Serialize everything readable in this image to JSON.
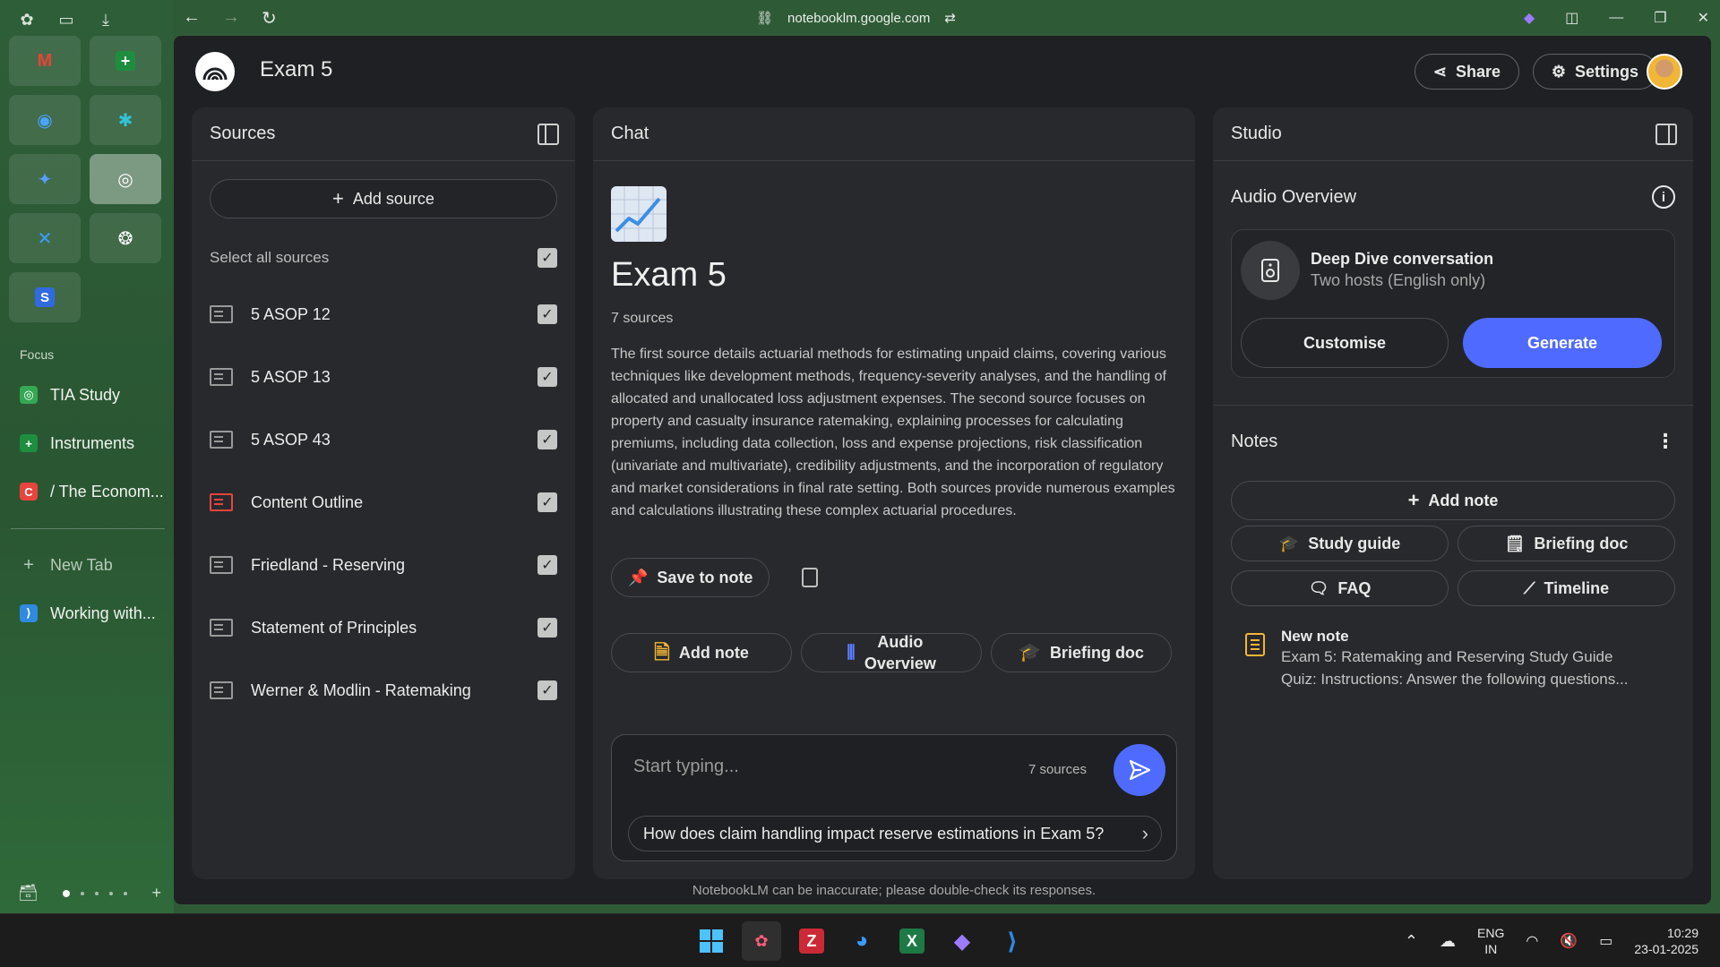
{
  "browser": {
    "url": "notebooklm.google.com",
    "focus_label": "Focus",
    "focus_items": [
      {
        "label": "TIA Study",
        "icon": "tia-study-icon",
        "color": "#34a853"
      },
      {
        "label": "Instruments",
        "icon": "sheets-icon",
        "color": "#1e8e3e"
      },
      {
        "label": "/ The Econom...",
        "icon": "economist-icon",
        "color": "#e8453c"
      }
    ],
    "new_tab_label": "New Tab",
    "pinned_item": {
      "label": "Working with...",
      "icon": "vscode-icon",
      "color": "#2f8ae0"
    }
  },
  "header": {
    "title": "Exam 5",
    "share_label": "Share",
    "settings_label": "Settings"
  },
  "sources": {
    "title": "Sources",
    "add_source_label": "Add source",
    "select_all_label": "Select all sources",
    "items": [
      {
        "name": "5 ASOP 12",
        "type": "text"
      },
      {
        "name": "5 ASOP 13",
        "type": "text"
      },
      {
        "name": "5 ASOP 43",
        "type": "text"
      },
      {
        "name": "Content Outline",
        "type": "pdf"
      },
      {
        "name": "Friedland - Reserving",
        "type": "text"
      },
      {
        "name": "Statement of Principles",
        "type": "text"
      },
      {
        "name": "Werner & Modlin - Ratemaking",
        "type": "text"
      }
    ]
  },
  "chat": {
    "title": "Chat",
    "notebook_title": "Exam 5",
    "source_count": "7 sources",
    "summary": "The first source details actuarial methods for estimating unpaid claims, covering various techniques like development methods, frequency-severity analyses, and the handling of allocated and unallocated loss adjustment expenses. The second source focuses on property and casualty insurance ratemaking, explaining processes for calculating premiums, including data collection, loss and expense projections, risk classification (univariate and multivariate), credibility adjustments, and the incorporation of regulatory and market considerations in final rate setting. Both sources provide numerous examples and calculations illustrating these complex actuarial procedures.",
    "save_to_note_label": "Save to note",
    "quick_actions": [
      {
        "label": "Add note",
        "icon": "note-icon"
      },
      {
        "label": "Audio Overview",
        "icon": "audio-wave-icon"
      },
      {
        "label": "Briefing doc",
        "icon": "graduation-cap-icon"
      }
    ],
    "input_placeholder": "Start typing...",
    "input_source_count": "7 sources",
    "suggestion": "How does claim handling impact reserve estimations in Exam 5?",
    "disclaimer": "NotebookLM can be inaccurate; please double-check its responses."
  },
  "studio": {
    "title": "Studio",
    "audio_overview_label": "Audio Overview",
    "audio_card_title": "Deep Dive conversation",
    "audio_card_subtitle": "Two hosts (English only)",
    "customise_label": "Customise",
    "generate_label": "Generate",
    "notes_label": "Notes",
    "add_note_label": "Add note",
    "note_buttons": [
      {
        "label": "Study guide",
        "icon": "graduation-cap-icon"
      },
      {
        "label": "Briefing doc",
        "icon": "briefing-doc-icon"
      },
      {
        "label": "FAQ",
        "icon": "faq-icon"
      },
      {
        "label": "Timeline",
        "icon": "timeline-icon"
      }
    ],
    "note": {
      "title": "New note",
      "line1": "Exam 5: Ratemaking and Reserving Study Guide",
      "line2": "Quiz: Instructions: Answer the following questions..."
    }
  },
  "taskbar": {
    "lang_line1": "ENG",
    "lang_line2": "IN",
    "time": "10:29",
    "date": "23-01-2025"
  },
  "colors": {
    "accent": "#4f6bff",
    "panel_bg": "#28292d",
    "app_bg": "#1f2023",
    "browser_green": "#2f5a36"
  }
}
